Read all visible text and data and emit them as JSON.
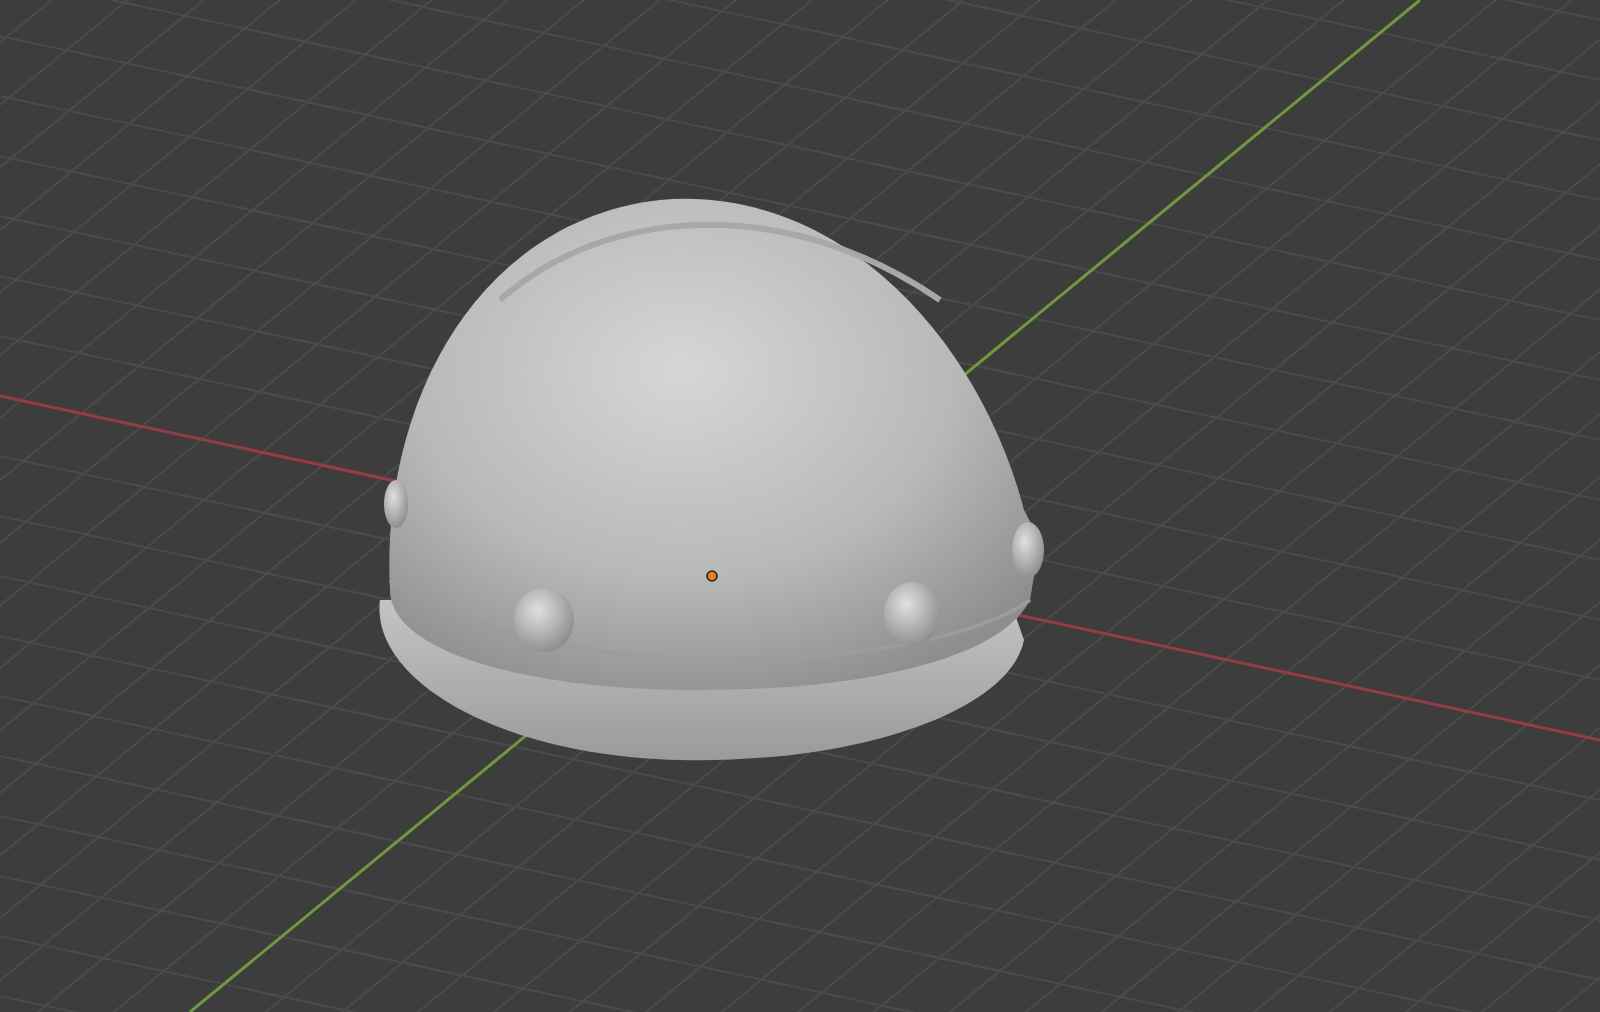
{
  "viewport": {
    "show_grid": true,
    "show_axes": true,
    "show_origin": true
  }
}
